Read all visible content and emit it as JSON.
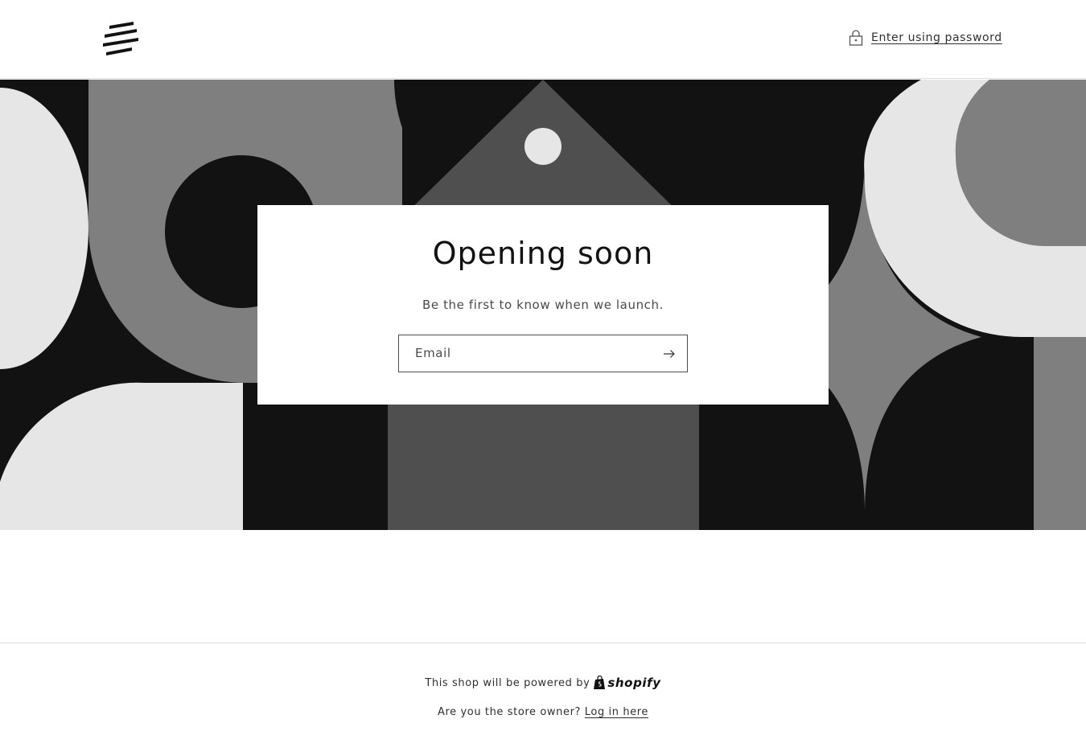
{
  "header": {
    "logo_icon": "stripes-logo",
    "password_link": "Enter using password",
    "lock_icon": "lock-icon"
  },
  "hero": {
    "colors": {
      "black": "#121212",
      "mid_gray": "#7f7f7f",
      "dark_gray": "#4f4f4f",
      "light_gray": "#e6e6e6"
    }
  },
  "signup": {
    "title": "Opening soon",
    "subtitle": "Be the first to know when we launch.",
    "email_placeholder": "Email",
    "submit_icon": "arrow-right-icon"
  },
  "footer": {
    "powered_text": "This shop will be powered by",
    "shopify_wordmark": "shopify",
    "owner_text": "Are you the store owner?",
    "login_link": "Log in here"
  }
}
